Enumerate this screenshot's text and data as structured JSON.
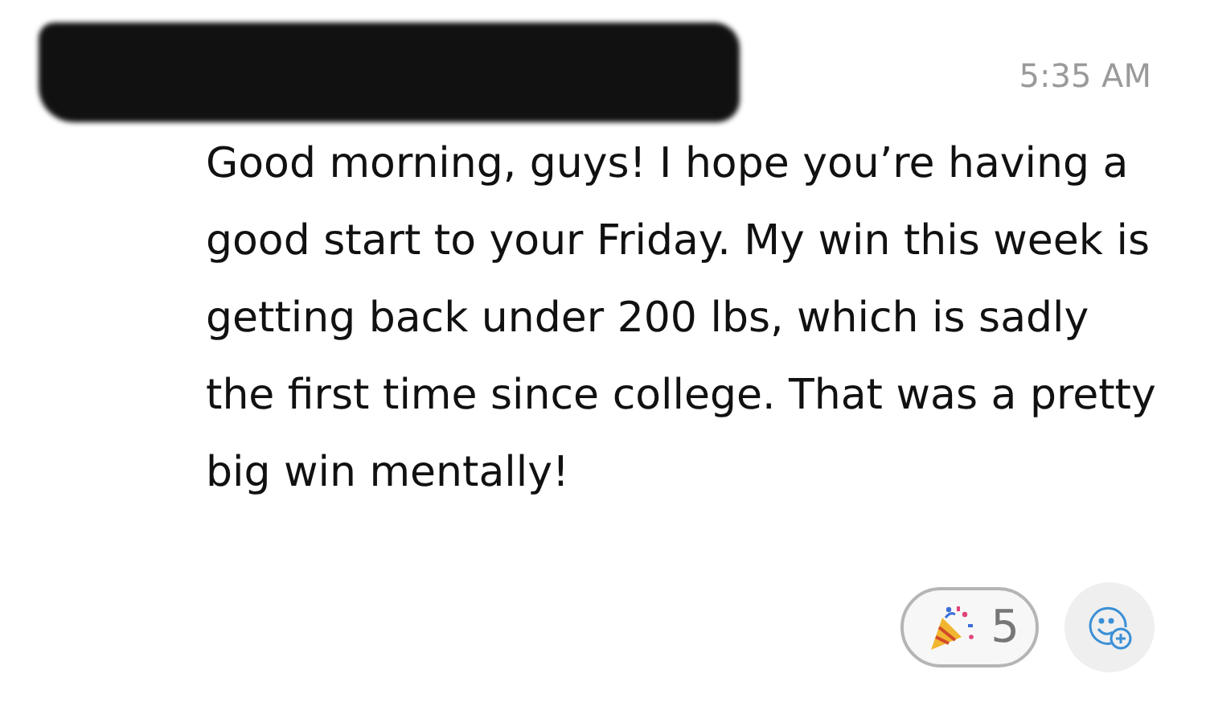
{
  "message": {
    "sender_redacted": true,
    "time": "5:35 AM",
    "text": "Good morning, guys! I hope you’re having a good start to your Friday. My win this week is getting back under 200 lbs, which is sadly the first time since college. That was a pretty big win mentally!"
  },
  "reactions": [
    {
      "kind": "party",
      "count": "5",
      "selected": false
    }
  ],
  "add_reaction": true
}
